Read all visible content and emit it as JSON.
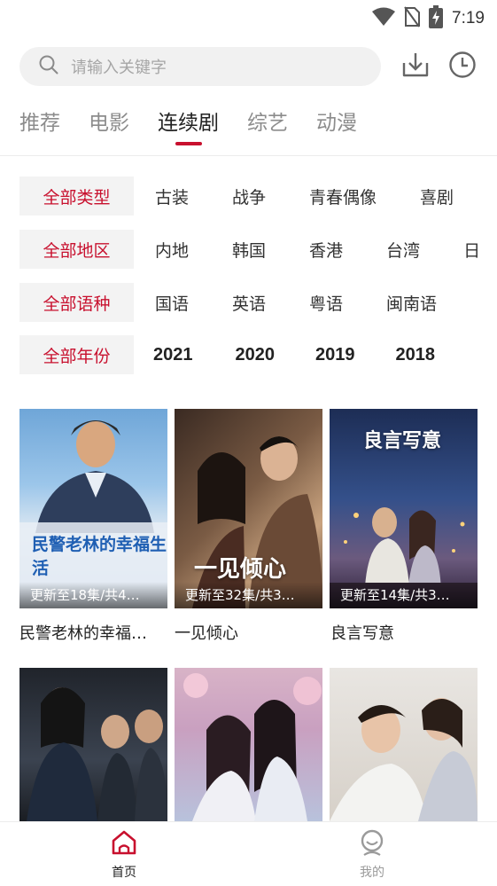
{
  "status": {
    "time": "7:19"
  },
  "search": {
    "placeholder": "请输入关键字"
  },
  "tabs": [
    {
      "label": "推荐",
      "active": false
    },
    {
      "label": "电影",
      "active": false
    },
    {
      "label": "连续剧",
      "active": true
    },
    {
      "label": "综艺",
      "active": false
    },
    {
      "label": "动漫",
      "active": false
    }
  ],
  "filters": [
    {
      "label": "全部类型",
      "options": [
        "古装",
        "战争",
        "青春偶像",
        "喜剧"
      ]
    },
    {
      "label": "全部地区",
      "options": [
        "内地",
        "韩国",
        "香港",
        "台湾",
        "日"
      ]
    },
    {
      "label": "全部语种",
      "options": [
        "国语",
        "英语",
        "粤语",
        "闽南语"
      ]
    },
    {
      "label": "全部年份",
      "options": [
        "2021",
        "2020",
        "2019",
        "2018"
      ]
    }
  ],
  "items": [
    {
      "badge": "更新至18集/共4…",
      "title": "民警老林的幸福…",
      "art_text": "民警老林的幸福生活"
    },
    {
      "badge": "更新至32集/共3…",
      "title": "一见倾心",
      "art_text": "一见倾心"
    },
    {
      "badge": "更新至14集/共3…",
      "title": "良言写意",
      "art_text": "良言写意"
    },
    {
      "badge": "",
      "title": "",
      "art_text": ""
    },
    {
      "badge": "",
      "title": "",
      "art_text": ""
    },
    {
      "badge": "",
      "title": "",
      "art_text": ""
    }
  ],
  "nav": {
    "home_label": "首页",
    "mine_label": "我的"
  },
  "colors": {
    "accent": "#c8102e",
    "inactive": "#8c8c8c",
    "filter_bg": "#f3f3f3"
  }
}
